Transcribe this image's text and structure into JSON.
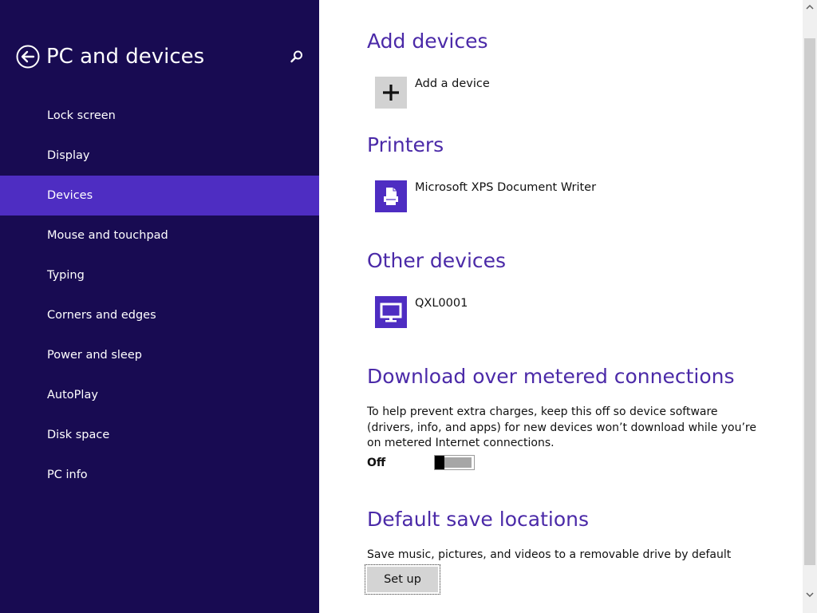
{
  "sidebar": {
    "title": "PC and devices",
    "back_icon": "back-arrow-icon",
    "search_icon": "search-icon",
    "items": [
      {
        "label": "Lock screen",
        "selected": false
      },
      {
        "label": "Display",
        "selected": false
      },
      {
        "label": "Devices",
        "selected": true
      },
      {
        "label": "Mouse and touchpad",
        "selected": false
      },
      {
        "label": "Typing",
        "selected": false
      },
      {
        "label": "Corners and edges",
        "selected": false
      },
      {
        "label": "Power and sleep",
        "selected": false
      },
      {
        "label": "AutoPlay",
        "selected": false
      },
      {
        "label": "Disk space",
        "selected": false
      },
      {
        "label": "PC info",
        "selected": false
      }
    ]
  },
  "main": {
    "add_devices": {
      "heading": "Add devices",
      "add_label": "Add a device",
      "icon": "plus-icon"
    },
    "printers": {
      "heading": "Printers",
      "items": [
        {
          "label": "Microsoft XPS Document Writer",
          "icon": "printer-icon"
        }
      ]
    },
    "other_devices": {
      "heading": "Other devices",
      "items": [
        {
          "label": "QXL0001",
          "icon": "monitor-icon"
        }
      ]
    },
    "metered": {
      "heading": "Download over metered connections",
      "description": "To help prevent extra charges, keep this off so device software (drivers, info, and apps) for new devices won’t download while you’re on metered Internet connections.",
      "toggle_state": "Off",
      "toggle_on": false
    },
    "save_locations": {
      "heading": "Default save locations",
      "description": "Save music, pictures, and videos to a removable drive by default",
      "button_label": "Set up"
    }
  },
  "colors": {
    "sidebar_bg": "#180b52",
    "selected_bg": "#4e2dc2",
    "heading": "#4b2aa8",
    "tile_accent": "#4e2dc2"
  }
}
